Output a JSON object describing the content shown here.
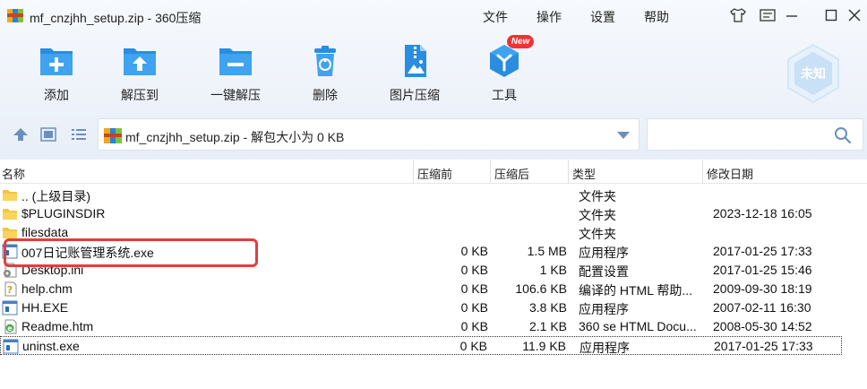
{
  "window": {
    "title": "mf_cnzjhh_setup.zip - 360压缩",
    "menu": [
      "文件",
      "操作",
      "设置",
      "帮助"
    ]
  },
  "toolbar": {
    "items": [
      {
        "label": "添加",
        "icon": "add-icon"
      },
      {
        "label": "解压到",
        "icon": "extract-to-icon"
      },
      {
        "label": "一键解压",
        "icon": "one-click-extract-icon"
      },
      {
        "label": "删除",
        "icon": "delete-icon"
      },
      {
        "label": "图片压缩",
        "icon": "image-compress-icon"
      },
      {
        "label": "工具",
        "icon": "tools-icon"
      }
    ],
    "new_badge": "New",
    "avatar_text": "未知"
  },
  "address": {
    "path": "mf_cnzjhh_setup.zip - 解包大小为 0 KB",
    "search_placeholder": ""
  },
  "columns": [
    "名称",
    "压缩前",
    "压缩后",
    "类型",
    "修改日期"
  ],
  "files": [
    {
      "name": ".. (上级目录)",
      "before": "",
      "after": "",
      "type": "文件夹",
      "date": "",
      "icon": "folder"
    },
    {
      "name": "$PLUGINSDIR",
      "before": "",
      "after": "",
      "type": "文件夹",
      "date": "2023-12-18 16:05",
      "icon": "folder"
    },
    {
      "name": "filesdata",
      "before": "",
      "after": "",
      "type": "文件夹",
      "date": "",
      "icon": "folder"
    },
    {
      "name": "007日记账管理系统.exe",
      "before": "0 KB",
      "after": "1.5 MB",
      "type": "应用程序",
      "date": "2017-01-25 17:33",
      "icon": "exe"
    },
    {
      "name": "Desktop.ini",
      "before": "0 KB",
      "after": "1 KB",
      "type": "配置设置",
      "date": "2017-01-25 15:46",
      "icon": "ini"
    },
    {
      "name": "help.chm",
      "before": "0 KB",
      "after": "106.6 KB",
      "type": "编译的 HTML 帮助...",
      "date": "2009-09-30 18:19",
      "icon": "chm"
    },
    {
      "name": "HH.EXE",
      "before": "0 KB",
      "after": "3.8 KB",
      "type": "应用程序",
      "date": "2007-02-11 16:30",
      "icon": "exe"
    },
    {
      "name": "Readme.htm",
      "before": "0 KB",
      "after": "2.1 KB",
      "type": "360 se HTML Docu...",
      "date": "2008-05-30 14:52",
      "icon": "htm"
    },
    {
      "name": "uninst.exe",
      "before": "0 KB",
      "after": "11.9 KB",
      "type": "应用程序",
      "date": "2017-01-25 17:33",
      "icon": "exe"
    }
  ]
}
